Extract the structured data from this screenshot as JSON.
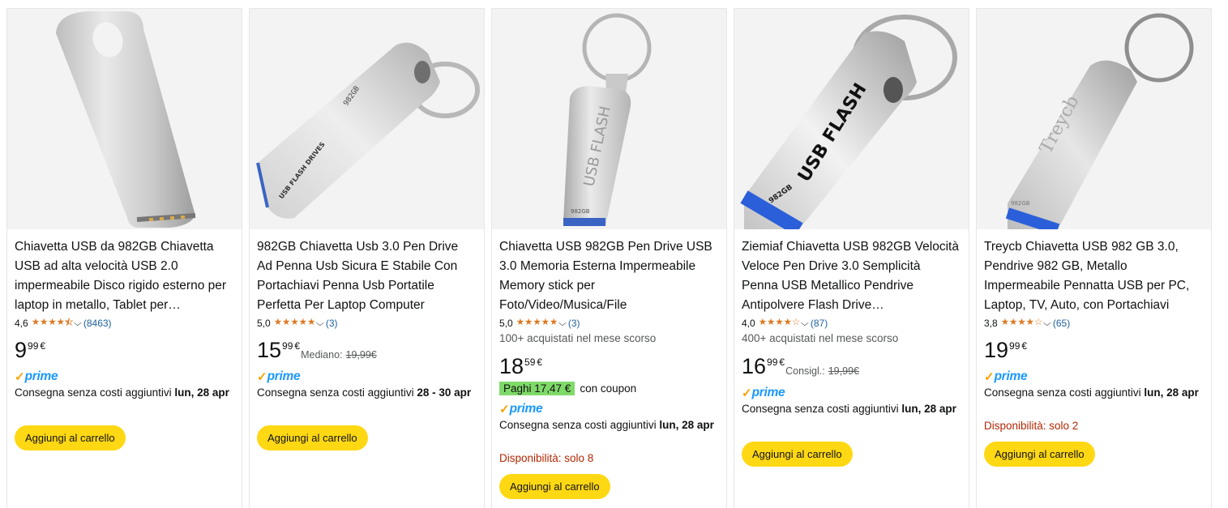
{
  "products": [
    {
      "title": "Chiavetta USB da 982GB Chiavetta USB ad alta velocità USB 2.0 impermeabile Disco rigido esterno per laptop in metallo, Tablet per…",
      "rating": "4,6",
      "stars": 4.5,
      "reviews": "(8463)",
      "price_whole": "9",
      "price_fraction": "99",
      "currency": "€",
      "prime": "prime",
      "delivery_prefix": "Consegna senza costi aggiuntivi",
      "delivery_date": "lun, 28 apr",
      "cart_label": "Aggiungi al carrello"
    },
    {
      "title": "982GB Chiavetta Usb 3.0 Pen Drive Ad Penna Usb Sicura E Stabile Con Portachiavi Penna Usb Portatile Perfetta Per Laptop Computer",
      "rating": "5,0",
      "stars": 5,
      "reviews": "(3)",
      "price_whole": "15",
      "price_fraction": "99",
      "currency": "€",
      "ref_label": "Mediano:",
      "ref_price": "19,99€",
      "prime": "prime",
      "delivery_prefix": "Consegna senza costi aggiuntivi",
      "delivery_date": "28 - 30 apr",
      "cart_label": "Aggiungi al carrello"
    },
    {
      "title": "Chiavetta USB 982GB Pen Drive USB 3.0 Memoria Esterna Impermeabile Memory stick per Foto/Video/Musica/File",
      "rating": "5,0",
      "stars": 5,
      "reviews": "(3)",
      "bought": "100+ acquistati nel mese scorso",
      "price_whole": "18",
      "price_fraction": "59",
      "currency": "€",
      "coupon_badge": "Paghi 17,47 €",
      "coupon_text": "con coupon",
      "prime": "prime",
      "delivery_prefix": "Consegna senza costi aggiuntivi",
      "delivery_date": "lun, 28 apr",
      "availability": "Disponibilità: solo 8",
      "cart_label": "Aggiungi al carrello"
    },
    {
      "title": "Ziemiaf Chiavetta USB 982GB Velocità Veloce Pen Drive 3.0 Semplicità Penna USB Metallico Pendrive Antipolvere Flash Drive…",
      "rating": "4,0",
      "stars": 4,
      "reviews": "(87)",
      "bought": "400+ acquistati nel mese scorso",
      "price_whole": "16",
      "price_fraction": "99",
      "currency": "€",
      "ref_label": "Consigl.:",
      "ref_price": "19,99€",
      "prime": "prime",
      "delivery_prefix": "Consegna senza costi aggiuntivi",
      "delivery_date": "lun, 28 apr",
      "cart_label": "Aggiungi al carrello"
    },
    {
      "title": "Treycb Chiavetta USB 982 GB 3.0, Pendrive 982 GB, Metallo Impermeabile Pennatta USB per PC, Laptop, TV, Auto, con Portachiavi",
      "rating": "3,8",
      "stars": 4,
      "reviews": "(65)",
      "price_whole": "19",
      "price_fraction": "99",
      "currency": "€",
      "prime": "prime",
      "delivery_prefix": "Consegna senza costi aggiuntivi",
      "delivery_date": "lun, 28 apr",
      "availability": "Disponibilità: solo 2",
      "cart_label": "Aggiungi al carrello"
    }
  ],
  "image_labels": {
    "p2": [
      "982GB",
      "USB FLASH DRIVES"
    ],
    "p3": [
      "USB FLASH",
      "982GB"
    ],
    "p4": [
      "USB FLASH",
      "982GB"
    ],
    "p5": [
      "Treycb",
      "982GB"
    ]
  },
  "colors": {
    "star": "#de7921",
    "link": "#2162a1",
    "prime_blue": "#1a98ff",
    "prime_check": "#f7a100",
    "cart_button": "#ffd814",
    "coupon_badge": "#7fda69",
    "availability": "#b12704"
  },
  "icons": [
    "star-icon",
    "chevron-down-icon",
    "prime-check-icon"
  ]
}
